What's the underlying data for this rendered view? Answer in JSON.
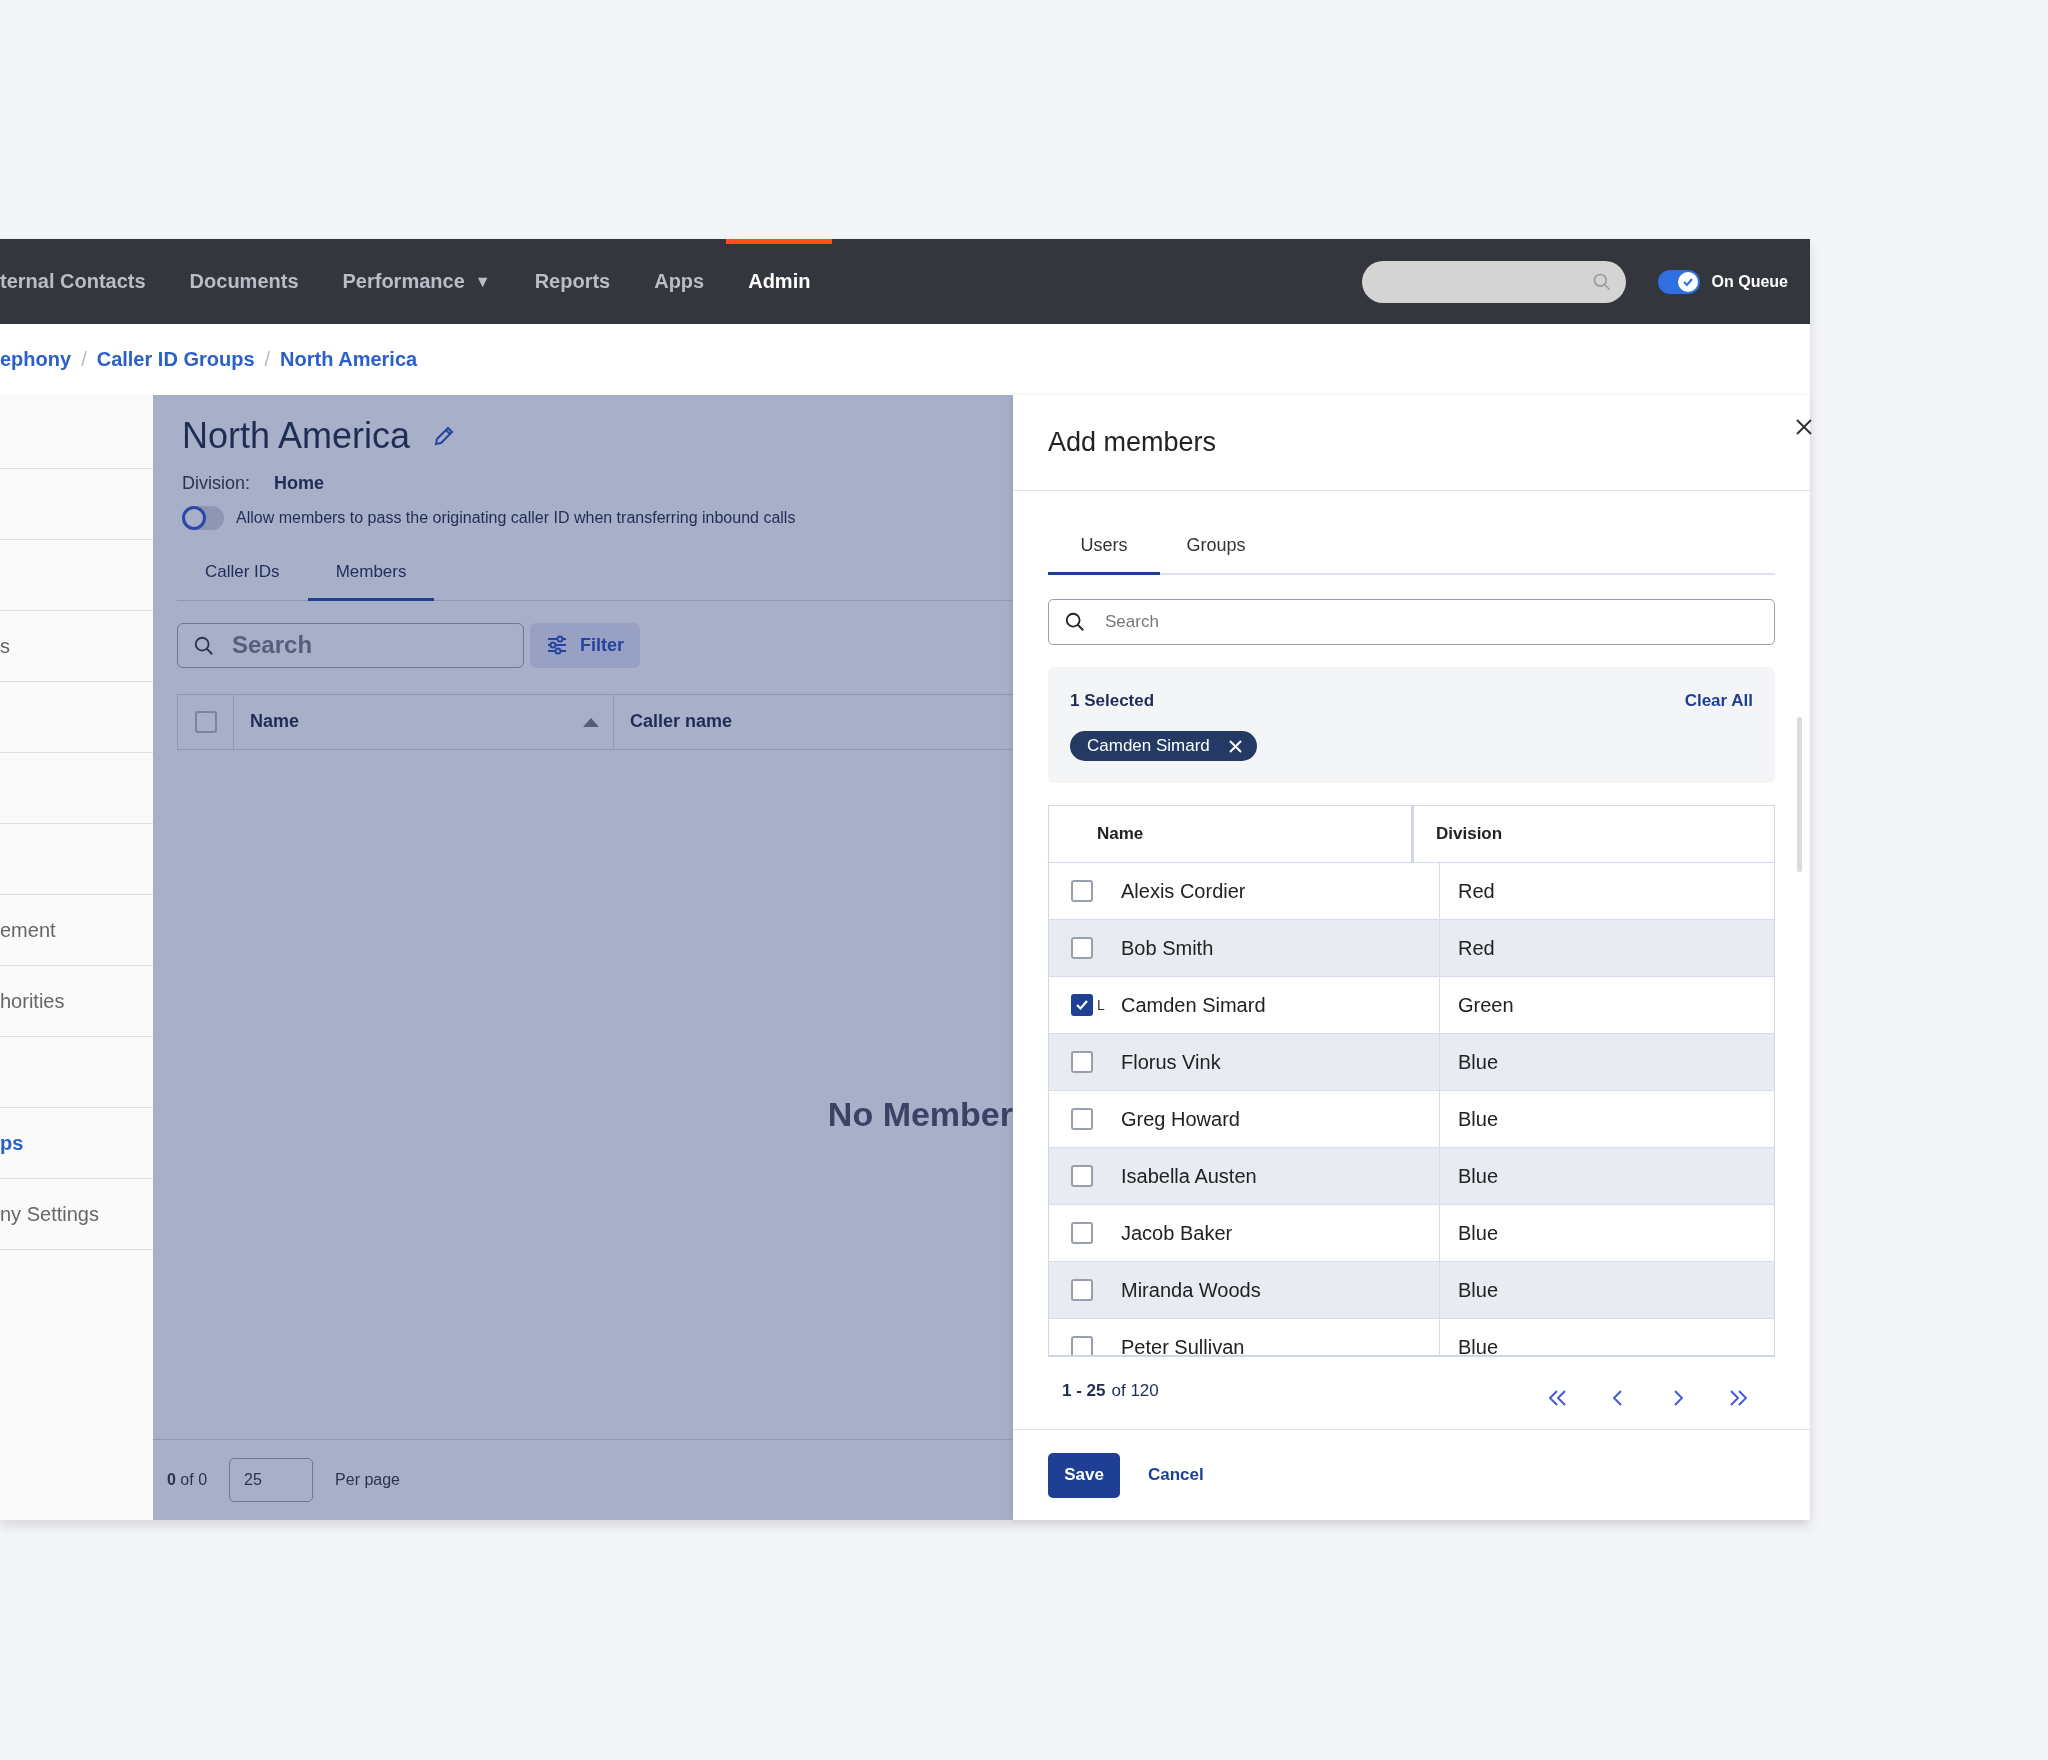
{
  "nav": {
    "items": [
      {
        "label": "ternal Contacts",
        "selected": false
      },
      {
        "label": "Documents",
        "selected": false
      },
      {
        "label": "Performance",
        "selected": false,
        "caret": "▼"
      },
      {
        "label": "Reports",
        "selected": false
      },
      {
        "label": "Apps",
        "selected": false
      },
      {
        "label": "Admin",
        "selected": true
      }
    ],
    "on_queue": {
      "label": "On Queue",
      "on": true
    }
  },
  "breadcrumb": {
    "separator": "/",
    "items": [
      "ephony",
      "Caller ID Groups",
      "North America"
    ]
  },
  "sidebar": {
    "items": [
      {
        "label": "s",
        "selected": false
      },
      {
        "label": "ement",
        "selected": false
      },
      {
        "label": "horities",
        "selected": false
      },
      {
        "label": "ps",
        "selected": true
      },
      {
        "label": "ny Settings",
        "selected": false
      }
    ]
  },
  "group": {
    "title": "North America",
    "division_label": "Division:",
    "division": "Home",
    "pass_caller_id": {
      "label": "Allow members to pass the originating caller ID when transferring inbound calls",
      "on": false
    },
    "tabs": [
      {
        "label": "Caller IDs",
        "selected": false
      },
      {
        "label": "Members",
        "selected": true
      }
    ],
    "search": {
      "placeholder": "Search"
    },
    "filter_button": "Filter",
    "table": {
      "select_all": false,
      "columns": [
        "Name",
        "Caller name"
      ]
    },
    "empty_message": "No Member",
    "pagination": {
      "count": "0",
      "of": "of",
      "total": "0",
      "per_page": "25",
      "per_page_label": "Per page"
    }
  },
  "drawer": {
    "title": "Add members",
    "tabs": [
      {
        "label": "Users",
        "selected": true
      },
      {
        "label": "Groups",
        "selected": false
      }
    ],
    "search": {
      "placeholder": "Search"
    },
    "selection": {
      "count_label": "1 Selected",
      "clear_all": "Clear All",
      "chips": [
        "Camden Simard"
      ]
    },
    "table": {
      "columns": [
        "Name",
        "Division"
      ],
      "rows": [
        {
          "name": "Alexis Cordier",
          "division": "Red",
          "checked": false
        },
        {
          "name": "Bob Smith",
          "division": "Red",
          "checked": false
        },
        {
          "name": "Camden Simard",
          "division": "Green",
          "checked": true,
          "mark": "L"
        },
        {
          "name": "Florus Vink",
          "division": "Blue",
          "checked": false
        },
        {
          "name": "Greg Howard",
          "division": "Blue",
          "checked": false
        },
        {
          "name": "Isabella Austen",
          "division": "Blue",
          "checked": false
        },
        {
          "name": "Jacob Baker",
          "division": "Blue",
          "checked": false
        },
        {
          "name": "Miranda Woods",
          "division": "Blue",
          "checked": false
        },
        {
          "name": "Peter Sullivan",
          "division": "Blue",
          "checked": false
        }
      ]
    },
    "pagination": {
      "range": "1 - 25",
      "of": "of",
      "total": "120"
    },
    "buttons": {
      "save": "Save",
      "cancel": "Cancel"
    }
  }
}
